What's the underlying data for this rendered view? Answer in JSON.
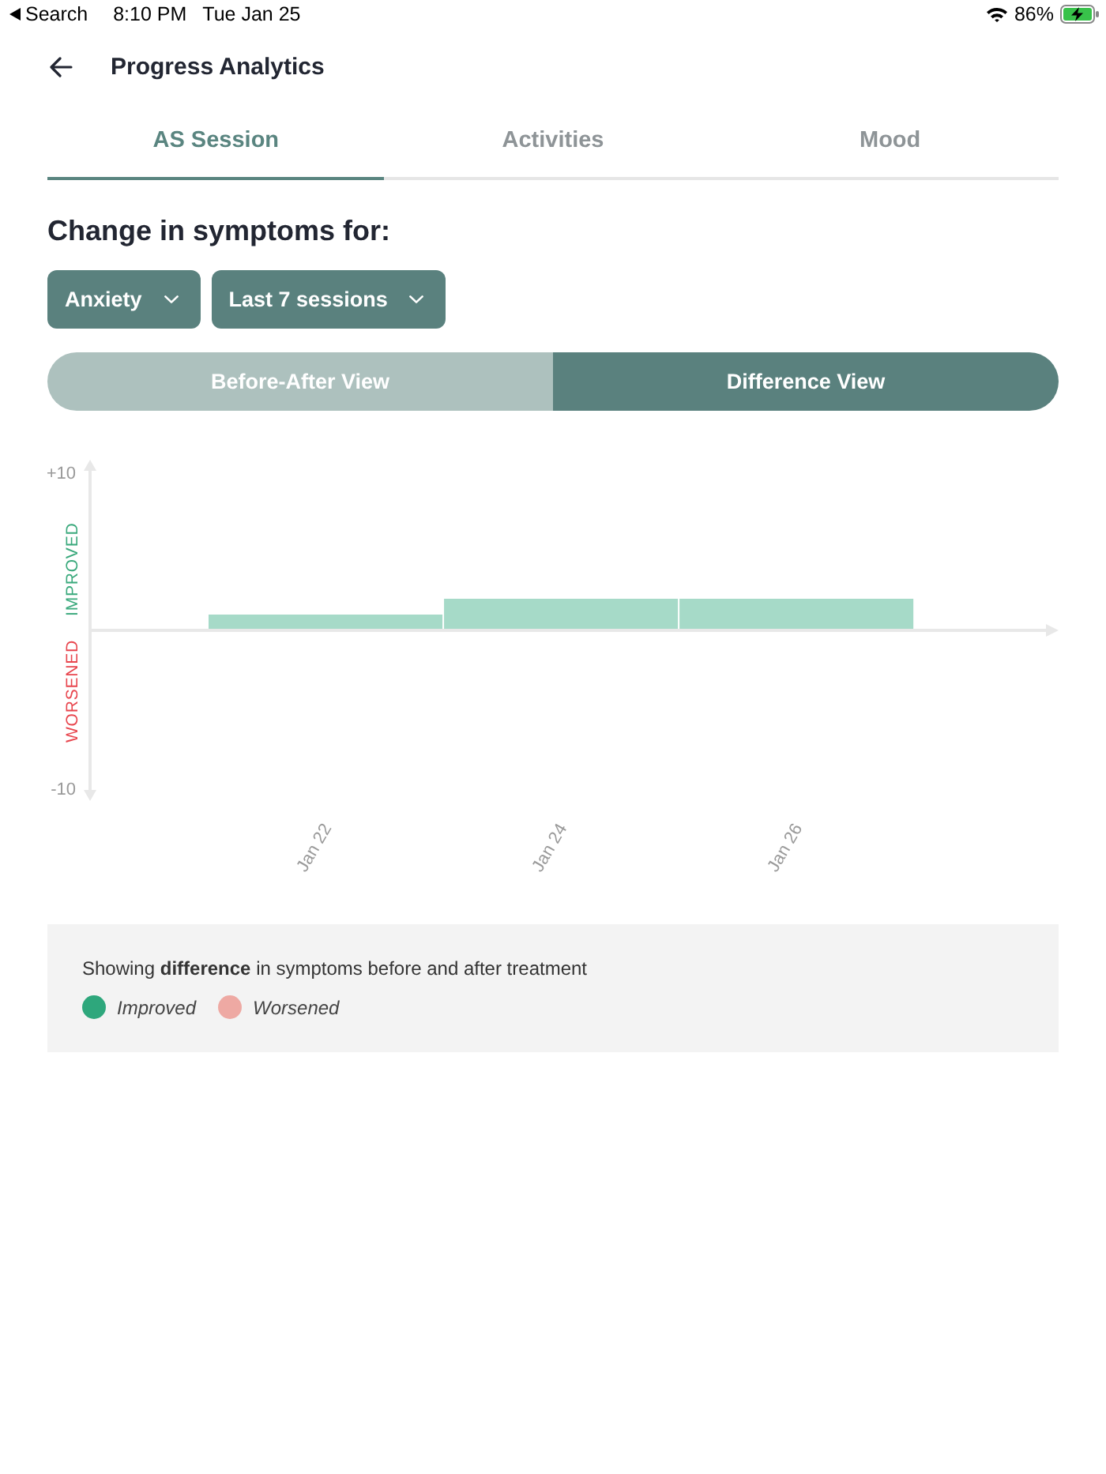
{
  "status_bar": {
    "back_label": "Search",
    "time": "8:10 PM",
    "date": "Tue Jan 25",
    "battery": "86%"
  },
  "header": {
    "title": "Progress Analytics"
  },
  "tabs": [
    {
      "label": "AS Session",
      "selected": true
    },
    {
      "label": "Activities",
      "selected": false
    },
    {
      "label": "Mood",
      "selected": false
    }
  ],
  "section": {
    "heading": "Change in symptoms for:",
    "dropdowns": [
      {
        "value": "Anxiety"
      },
      {
        "value": "Last 7 sessions"
      }
    ],
    "views": [
      {
        "label": "Before-After View",
        "selected": false
      },
      {
        "label": "Difference View",
        "selected": true
      }
    ]
  },
  "chart": {
    "axis_labels": [
      {
        "text": "IMPROVED",
        "color": "#3aa97c"
      },
      {
        "text": "WORSENED",
        "color": "#e8464e"
      }
    ],
    "chart_data": {
      "type": "bar",
      "categories": [
        "Jan 22",
        "Jan 24",
        "Jan 26"
      ],
      "series": [
        {
          "color": "#a6dac8",
          "values": [
            1,
            2,
            2
          ]
        }
      ],
      "ylim": [
        -10,
        10
      ],
      "yticks": [
        {
          "value": 10,
          "label": "+10"
        },
        {
          "value": -10,
          "label": "-10"
        }
      ]
    }
  },
  "legend": {
    "caption": "Showing **difference** in symptoms before and after treatment",
    "items": [
      {
        "label": "Improved",
        "color": "#2ea77c"
      },
      {
        "label": "Worsened",
        "color": "#eea9a3"
      }
    ]
  }
}
